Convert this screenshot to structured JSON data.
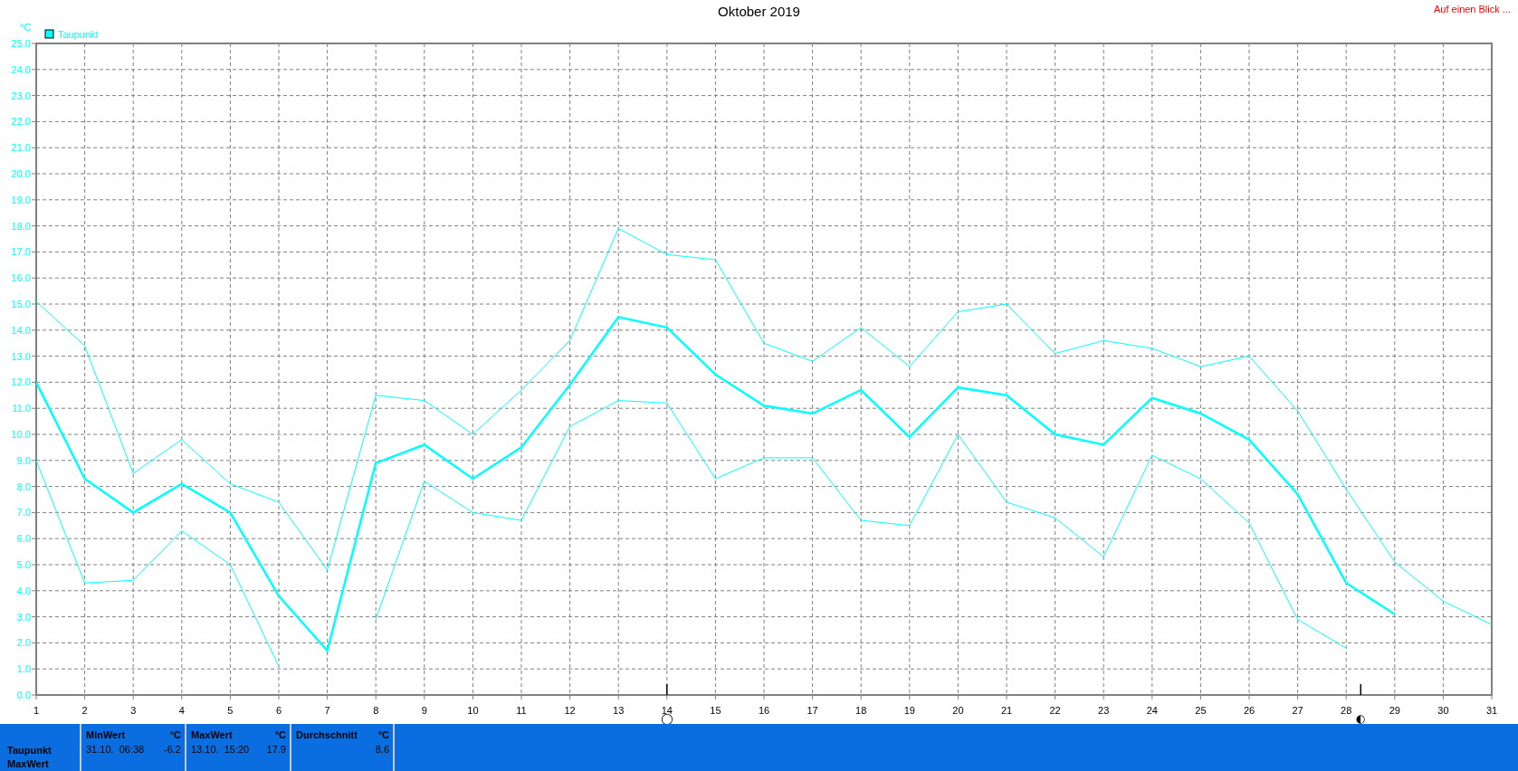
{
  "header": {
    "link": "Auf einen Blick ..."
  },
  "chart": {
    "legend": [
      {
        "label": "Taupunkt",
        "color": "#00ffff"
      }
    ],
    "line_styles": [
      {
        "bold": false
      },
      {
        "bold": true
      },
      {
        "bold": false
      }
    ],
    "chart_data": {
      "type": "line",
      "grid": true,
      "title": "Oktober 2019",
      "ylabel": "°C",
      "x": [
        1,
        2,
        3,
        4,
        5,
        6,
        7,
        8,
        9,
        10,
        11,
        12,
        13,
        14,
        15,
        16,
        17,
        18,
        19,
        20,
        21,
        22,
        23,
        24,
        25,
        26,
        27,
        28,
        29,
        30,
        31
      ],
      "series": [
        {
          "color": "#00ffff",
          "values": [
            15.1,
            13.4,
            8.5,
            9.8,
            8.1,
            7.4,
            4.8,
            11.5,
            11.3,
            10.0,
            11.7,
            13.6,
            17.9,
            16.9,
            16.7,
            13.5,
            12.8,
            14.1,
            12.6,
            14.7,
            15.0,
            13.1,
            13.6,
            13.3,
            12.6,
            13.0,
            10.9,
            7.9,
            5.1,
            3.6,
            2.7
          ]
        },
        {
          "color": "#00ffff",
          "values": [
            12.0,
            8.3,
            7.0,
            8.1,
            7.0,
            3.8,
            1.7,
            8.9,
            9.6,
            8.3,
            9.5,
            11.9,
            14.5,
            14.1,
            12.3,
            11.1,
            10.8,
            11.7,
            9.9,
            11.8,
            11.5,
            10.0,
            9.6,
            11.4,
            10.8,
            9.8,
            7.7,
            4.3,
            3.1,
            null,
            null
          ]
        },
        {
          "color": "#00ffff",
          "values": [
            9.0,
            4.3,
            4.4,
            6.3,
            5.0,
            1.1,
            null,
            2.9,
            8.2,
            7.0,
            6.7,
            10.3,
            11.3,
            11.2,
            8.3,
            9.1,
            9.1,
            6.7,
            6.5,
            10.0,
            7.4,
            6.8,
            5.3,
            9.2,
            8.3,
            6.6,
            2.9,
            1.8,
            null,
            null,
            null
          ]
        }
      ],
      "xlim": [
        1,
        31
      ],
      "ylim": [
        0,
        25
      ],
      "annotations": [
        "◯",
        "◐"
      ],
      "xticks": [
        1,
        2,
        3,
        4,
        5,
        6,
        7,
        8,
        9,
        10,
        11,
        12,
        13,
        14,
        15,
        16,
        17,
        18,
        19,
        20,
        21,
        22,
        23,
        24,
        25,
        26,
        27,
        28,
        29,
        30,
        31
      ],
      "yticks": [
        {
          "value": 0,
          "label": "0.0"
        },
        {
          "value": 1,
          "label": "1.0"
        },
        {
          "value": 2,
          "label": "2.0"
        },
        {
          "value": 3,
          "label": "3.0"
        },
        {
          "value": 4,
          "label": "4.0"
        },
        {
          "value": 5,
          "label": "5.0"
        },
        {
          "value": 6,
          "label": "6.0"
        },
        {
          "value": 7,
          "label": "7.0"
        },
        {
          "value": 8,
          "label": "8.0"
        },
        {
          "value": 9,
          "label": "9.0"
        },
        {
          "value": 10,
          "label": "10.0"
        },
        {
          "value": 11,
          "label": "11.0"
        },
        {
          "value": 12,
          "label": "12.0"
        },
        {
          "value": 13,
          "label": "13.0"
        },
        {
          "value": 14,
          "label": "14.0"
        },
        {
          "value": 15,
          "label": "15.0"
        },
        {
          "value": 16,
          "label": "16.0"
        },
        {
          "value": 17,
          "label": "17.0"
        },
        {
          "value": 18,
          "label": "18.0"
        },
        {
          "value": 19,
          "label": "19.0"
        },
        {
          "value": 20,
          "label": "20.0"
        },
        {
          "value": 21,
          "label": "21.0"
        },
        {
          "value": 22,
          "label": "22.0"
        },
        {
          "value": 23,
          "label": "23.0"
        },
        {
          "value": 24,
          "label": "24.0"
        },
        {
          "value": 25,
          "label": "25.0"
        }
      ]
    }
  },
  "summary": {
    "row_labels": [
      "Taupunkt",
      "MaxWert"
    ],
    "columns": [
      {
        "heading": "MinWert",
        "unit": "°C",
        "time": "31.10.  06:38",
        "value": "-6.2"
      },
      {
        "heading": "MaxWert",
        "unit": "°C",
        "time": "13.10.  15:20",
        "value": "17.9"
      },
      {
        "heading": "Durchschnitt",
        "unit": "°C",
        "value": "8.6"
      }
    ]
  }
}
